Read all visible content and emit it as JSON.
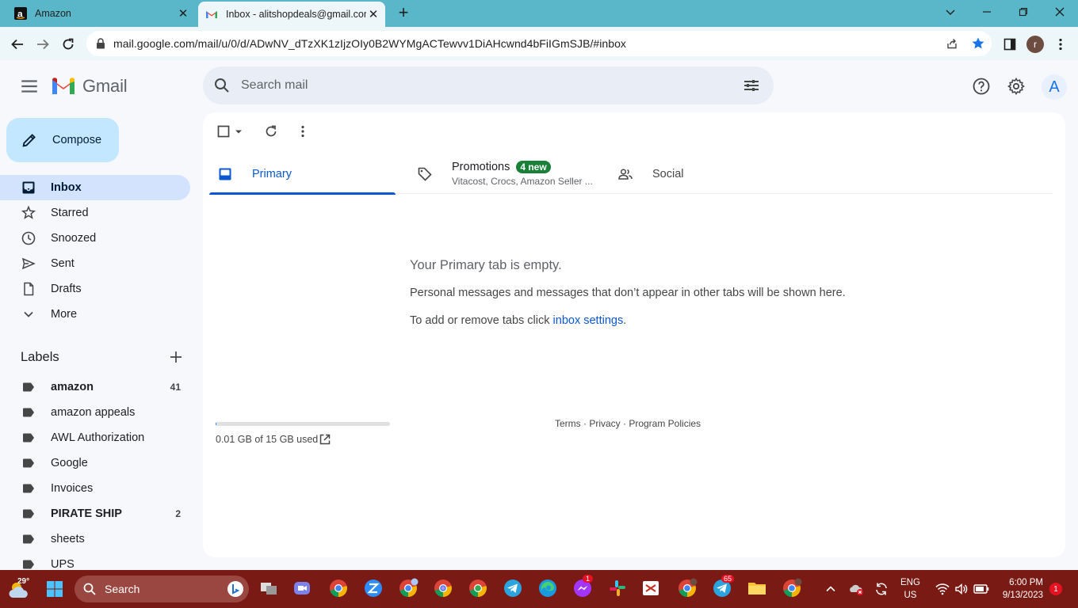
{
  "browser": {
    "tabs": [
      {
        "title": "Amazon",
        "favicon": "amazon-a-icon"
      },
      {
        "title": "Inbox - alitshopdeals@gmail.com",
        "favicon": "gmail-icon",
        "active": true
      }
    ],
    "url": "mail.google.com/mail/u/0/d/ADwNV_dTzXK1zIjzOIy0B2WYMgACTewvv1DiAHcwnd4bFiIGmSJB/#inbox",
    "profile_initial": "r",
    "accent": "#59b7c9"
  },
  "gmail": {
    "logo_text": "Gmail",
    "search_placeholder": "Search mail",
    "account_initial": "A",
    "compose_label": "Compose",
    "nav": [
      {
        "label": "Inbox",
        "icon": "inbox-icon",
        "active": true
      },
      {
        "label": "Starred",
        "icon": "star-icon"
      },
      {
        "label": "Snoozed",
        "icon": "clock-icon"
      },
      {
        "label": "Sent",
        "icon": "send-icon"
      },
      {
        "label": "Drafts",
        "icon": "draft-icon"
      },
      {
        "label": "More",
        "icon": "chevron-down-icon"
      }
    ],
    "labels_heading": "Labels",
    "labels": [
      {
        "name": "amazon",
        "count": "41",
        "bold": true
      },
      {
        "name": "amazon appeals",
        "count": ""
      },
      {
        "name": "AWL Authorization",
        "count": ""
      },
      {
        "name": "Google",
        "count": ""
      },
      {
        "name": "Invoices",
        "count": ""
      },
      {
        "name": "PIRATE SHIP",
        "count": "2",
        "bold": true
      },
      {
        "name": "sheets",
        "count": ""
      },
      {
        "name": "UPS",
        "count": ""
      }
    ],
    "inbox_tabs": {
      "primary": "Primary",
      "promotions": "Promotions",
      "promotions_badge": "4 new",
      "promotions_senders": "Vitacost, Crocs, Amazon Seller ...",
      "social": "Social"
    },
    "empty": {
      "title": "Your Primary tab is empty.",
      "description": "Personal messages and messages that don’t appear in other tabs will be shown here.",
      "settings_prefix": "To add or remove tabs click ",
      "settings_link": "inbox settings",
      "settings_suffix": "."
    },
    "storage": {
      "text": "0.01 GB of 15 GB used",
      "fraction": 0.0007
    },
    "footer": "Terms · Privacy · Program Policies"
  },
  "taskbar": {
    "temperature": "29°",
    "search_label": "Search",
    "messenger_badge": "1",
    "telegram_badge": "65",
    "language_top": "ENG",
    "language_bottom": "US",
    "time": "6:00 PM",
    "date": "9/13/2023",
    "notification_count": "1",
    "color": "#7a1a14"
  }
}
